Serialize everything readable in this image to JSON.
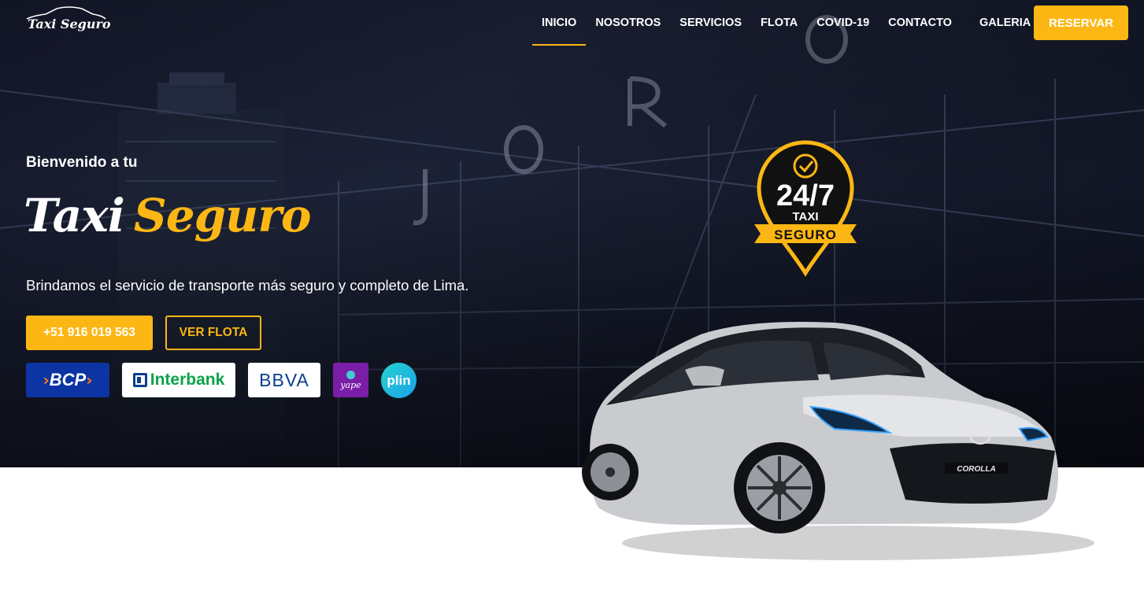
{
  "header": {
    "logo_text": "Taxi Seguro",
    "nav": [
      {
        "label": "INICIO",
        "active": true
      },
      {
        "label": "NOSOTROS"
      },
      {
        "label": "SERVICIOS"
      },
      {
        "label": "FLOTA"
      },
      {
        "label": "COVID-19"
      },
      {
        "label": "CONTACTO"
      },
      {
        "label": "GALERIA"
      }
    ],
    "reserve_label": "RESERVAR"
  },
  "hero": {
    "welcome": "Bienvenido a tu",
    "title_part1": "Taxi",
    "title_part2": "Seguro",
    "subtitle": "Brindamos el servicio de transporte más seguro y completo de Lima.",
    "phone_button": "+51 916 019 563",
    "fleet_button": "VER FLOTA"
  },
  "payments": {
    "bcp": "BCP",
    "interbank": "Interbank",
    "bbva": "BBVA",
    "yape": "yape",
    "plin": "plin"
  },
  "badge": {
    "hours": "24/7",
    "line1": "TAXI",
    "line2": "SEGURO"
  },
  "car": {
    "plate": "COROLLA"
  },
  "colors": {
    "accent": "#fdb714",
    "hero_bg": "#161b2c",
    "white": "#ffffff"
  }
}
